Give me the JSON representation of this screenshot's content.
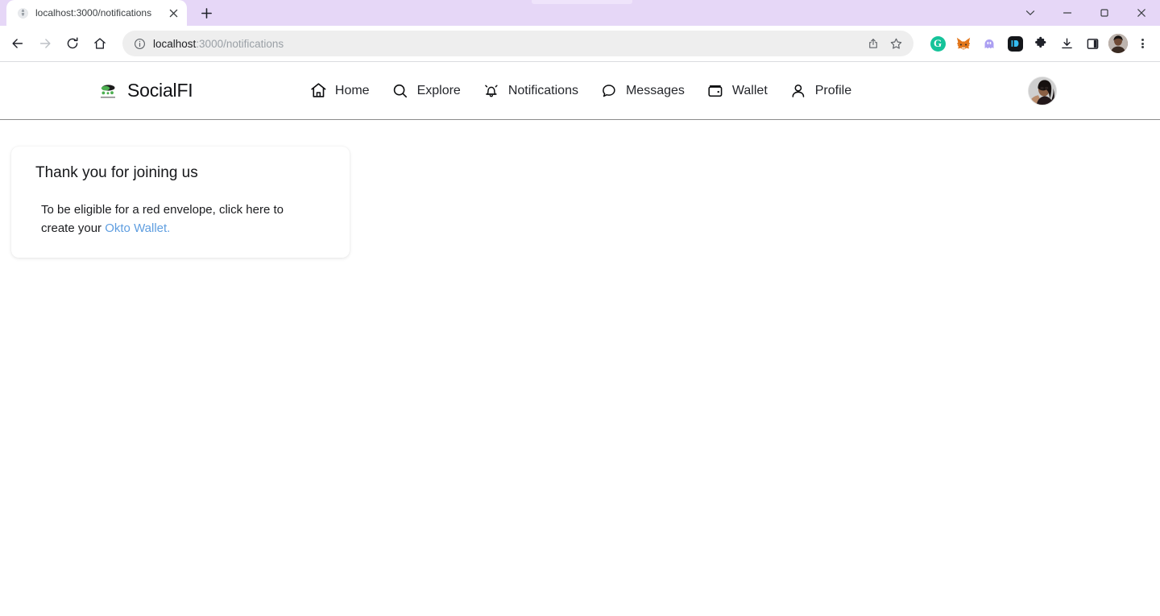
{
  "browser": {
    "tab": {
      "title": "localhost:3000/notifications",
      "favicon_icon": "globe-icon",
      "close_icon": "close-icon"
    },
    "new_tab_label": "+",
    "window_controls": [
      {
        "name": "tab-search",
        "icon": "chevron-down-icon",
        "glyph": "⌄"
      },
      {
        "name": "minimize",
        "icon": "minimize-icon",
        "glyph": "–"
      },
      {
        "name": "maximize",
        "icon": "maximize-icon",
        "glyph": "□"
      },
      {
        "name": "close-window",
        "icon": "close-icon",
        "glyph": "✕"
      }
    ],
    "nav": {
      "back_icon": "back-arrow-icon",
      "forward_icon": "forward-arrow-icon",
      "reload_icon": "reload-icon",
      "home_icon": "home-icon"
    },
    "omnibox": {
      "info_icon": "info-circle-icon",
      "url_host": "localhost",
      "url_path": ":3000/notifications",
      "full_url": "localhost:3000/notifications",
      "share_icon": "share-icon",
      "bookmark_icon": "star-icon"
    },
    "extensions": [
      {
        "name": "grammarly-extension",
        "label": "G"
      },
      {
        "name": "metamask-extension",
        "label": ""
      },
      {
        "name": "phantom-extension",
        "label": ""
      },
      {
        "name": "id-extension",
        "label": ""
      },
      {
        "name": "extensions-puzzle",
        "label": ""
      },
      {
        "name": "downloads",
        "label": ""
      },
      {
        "name": "side-panel",
        "label": ""
      }
    ],
    "profile_name": "browser-profile-avatar",
    "menu_icon": "three-dot-menu-icon",
    "colors": {
      "titlebar": "#e6d7f7",
      "omnibox": "#eeeeee",
      "grammarly_green": "#15c39a"
    }
  },
  "app": {
    "brand": {
      "name": "SocialFI",
      "logo_icon": "socialfi-logo"
    },
    "nav_items": [
      {
        "label": "Home",
        "icon": "home-icon"
      },
      {
        "label": "Explore",
        "icon": "search-icon"
      },
      {
        "label": "Notifications",
        "icon": "bell-ring-icon"
      },
      {
        "label": "Messages",
        "icon": "chat-bubble-icon"
      },
      {
        "label": "Wallet",
        "icon": "wallet-icon"
      },
      {
        "label": "Profile",
        "icon": "user-icon"
      }
    ],
    "avatar_name": "user-avatar",
    "card": {
      "title": "Thank you for joining us",
      "body_prefix": "To be eligible for a red envelope, click here to create your ",
      "link_text": "Okto Wallet.",
      "link_color": "#5f9ee0"
    }
  }
}
